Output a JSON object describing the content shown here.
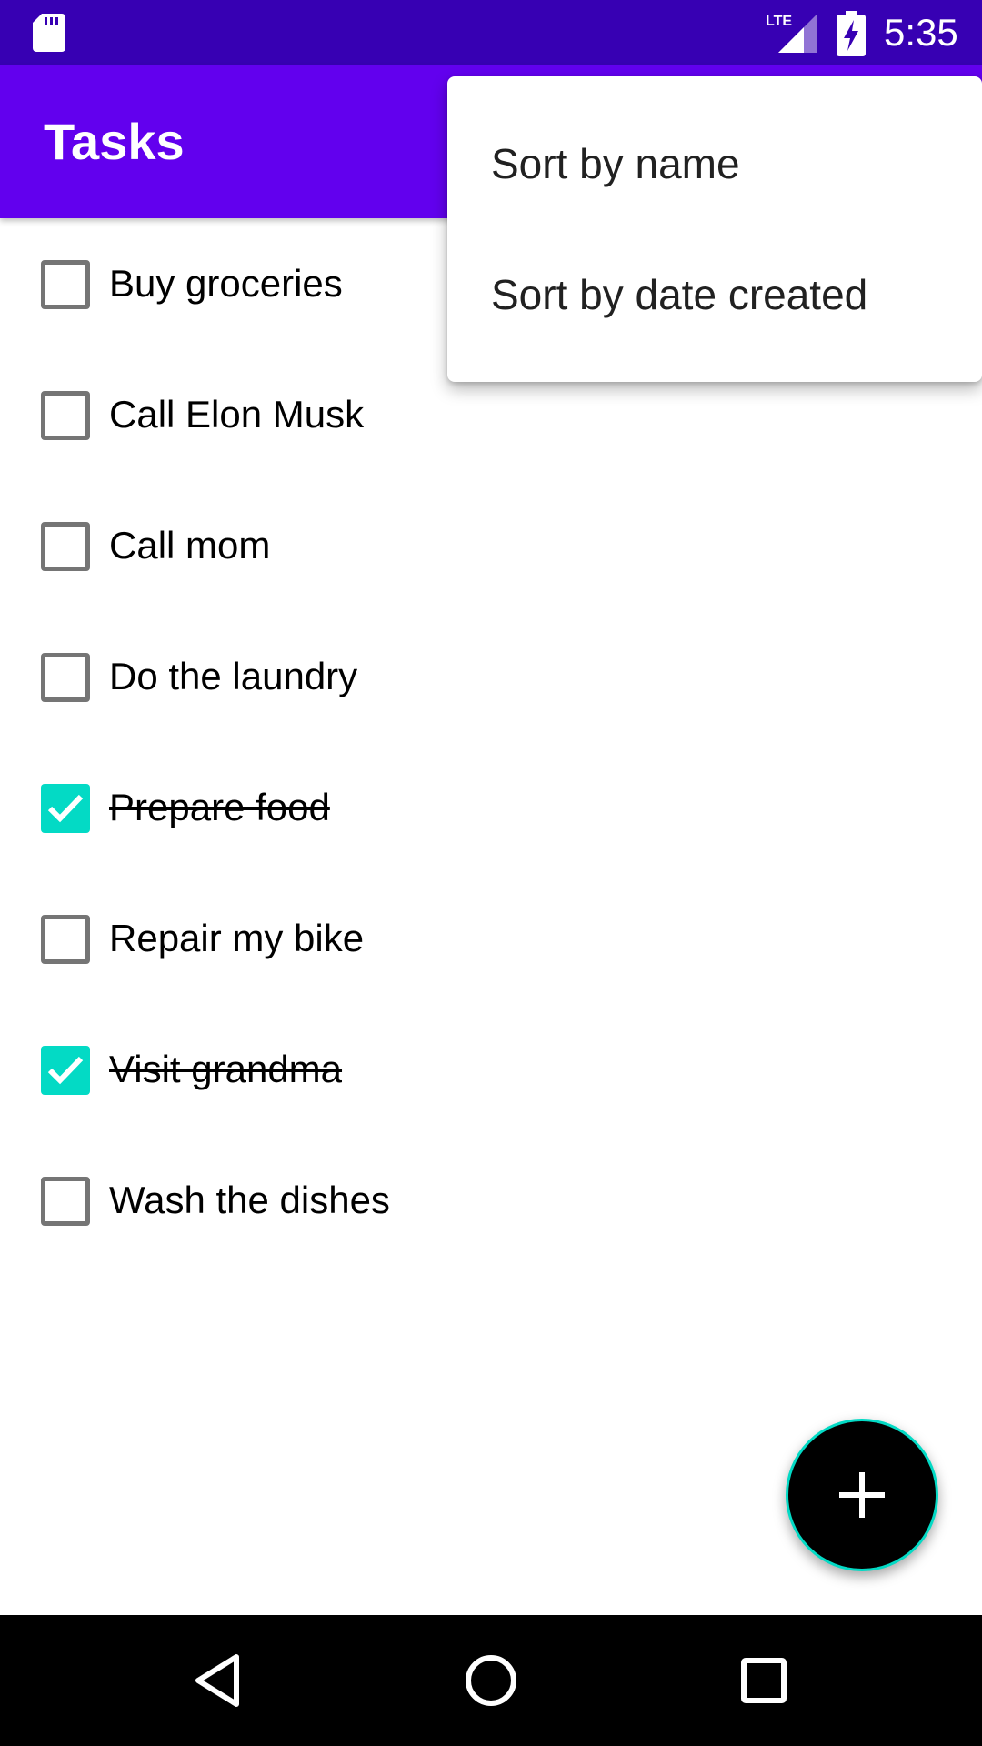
{
  "status_bar": {
    "time": "5:35",
    "network_label": "LTE",
    "icons": [
      "sd-card-icon",
      "lte-signal-icon",
      "battery-charging-icon"
    ]
  },
  "app_bar": {
    "title": "Tasks"
  },
  "tasks": [
    {
      "label": "Buy groceries",
      "checked": false
    },
    {
      "label": "Call Elon Musk",
      "checked": false
    },
    {
      "label": "Call mom",
      "checked": false
    },
    {
      "label": "Do the laundry",
      "checked": false
    },
    {
      "label": "Prepare food",
      "checked": true
    },
    {
      "label": "Repair my bike",
      "checked": false
    },
    {
      "label": "Visit grandma",
      "checked": true
    },
    {
      "label": "Wash the dishes",
      "checked": false
    }
  ],
  "menu": {
    "items": [
      {
        "label": "Sort by name"
      },
      {
        "label": "Sort by date created"
      }
    ]
  },
  "fab": {
    "icon": "plus-icon"
  },
  "nav_bar": {
    "icons": [
      "back-icon",
      "home-icon",
      "recents-icon"
    ]
  },
  "colors": {
    "primary": "#6200ee",
    "primary_dark": "#3700b3",
    "accent": "#03dac5",
    "checkbox_unchecked": "#757575"
  }
}
